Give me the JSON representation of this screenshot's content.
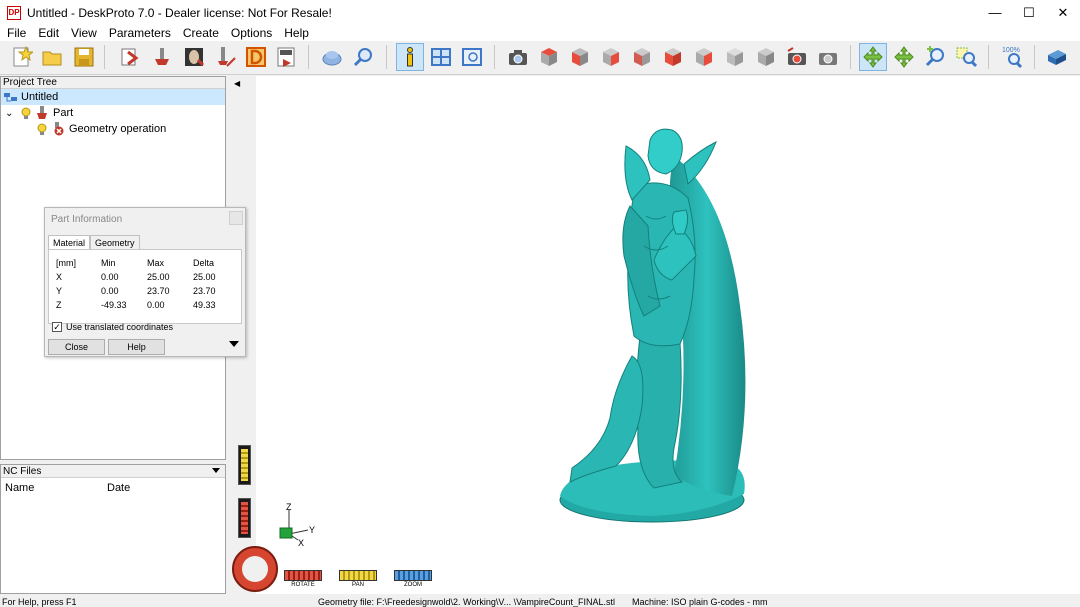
{
  "window": {
    "title": "Untitled - DeskProto 7.0 - Dealer license: Not For Resale!",
    "app_icon_text": "DP",
    "minimize": "—",
    "maximize": "☐",
    "close": "✕"
  },
  "menu": [
    "File",
    "Edit",
    "View",
    "Parameters",
    "Create",
    "Options",
    "Help"
  ],
  "toolbar": {
    "zoom_100_label": "100%"
  },
  "project_tree": {
    "header": "Project Tree",
    "root": "Untitled",
    "part": "Part",
    "operation": "Geometry operation",
    "expander": "⌄"
  },
  "nc_files": {
    "header": "NC Files",
    "col_name": "Name",
    "col_date": "Date"
  },
  "part_info": {
    "title": "Part Information",
    "tabs": [
      "Material",
      "Geometry"
    ],
    "headers": [
      "[mm]",
      "Min",
      "Max",
      "Delta"
    ],
    "rows": [
      [
        "X",
        "0.00",
        "25.00",
        "25.00"
      ],
      [
        "Y",
        "0.00",
        "23.70",
        "23.70"
      ],
      [
        "Z",
        "-49.33",
        "0.00",
        "49.33"
      ]
    ],
    "checkbox_label": "Use translated coordinates",
    "checkbox_mark": "✓",
    "close_label": "Close",
    "help_label": "Help"
  },
  "viewport": {
    "mode_labels": [
      "ROTATE",
      "PAN",
      "ZOOM"
    ],
    "axes": {
      "x": "X",
      "y": "Y",
      "z": "Z"
    },
    "collapse_arrow": "◀",
    "model_color": "#2ab7b3"
  },
  "statusbar": {
    "help": "For Help, press F1",
    "geometry": "Geometry file: F:\\Freedesignwold\\2. Working\\V... \\VampireCount_FINAL.stl",
    "machine": "Machine: ISO plain G-codes - mm"
  }
}
